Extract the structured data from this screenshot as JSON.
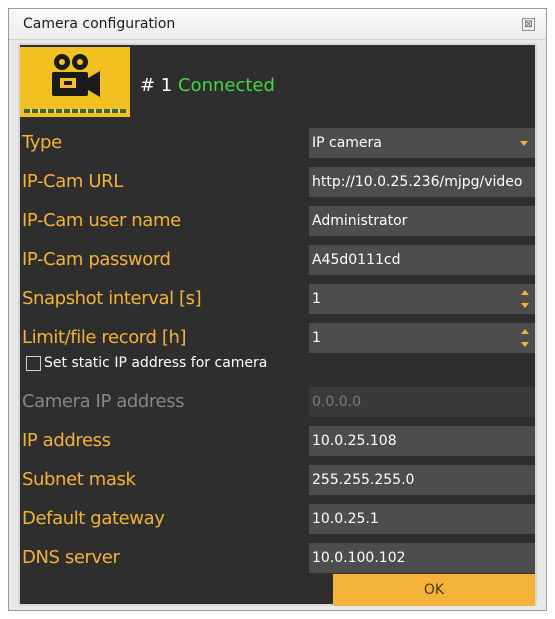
{
  "window": {
    "title": "Camera configuration",
    "close_glyph": "⊠"
  },
  "header": {
    "camera_number": "# 1",
    "status": "Connected",
    "icon": "film-camera-icon"
  },
  "fields": {
    "type": {
      "label": "Type",
      "value": "IP camera"
    },
    "url": {
      "label": "IP-Cam URL",
      "value": "http://10.0.25.236/mjpg/video"
    },
    "user": {
      "label": "IP-Cam user name",
      "value": "Administrator"
    },
    "password": {
      "label": "IP-Cam password",
      "value": "A45d0111cd"
    },
    "snapshot": {
      "label": "Snapshot interval [s]",
      "value": "1"
    },
    "limit": {
      "label": "Limit/file record [h]",
      "value": "1"
    },
    "camera_ip": {
      "label": "Camera IP address",
      "value": "0.0.0.0"
    },
    "ip": {
      "label": "IP address",
      "value": "10.0.25.108"
    },
    "subnet": {
      "label": "Subnet mask",
      "value": "255.255.255.0"
    },
    "gateway": {
      "label": "Default gateway",
      "value": "10.0.25.1"
    },
    "dns": {
      "label": "DNS server",
      "value": "10.0.100.102"
    }
  },
  "static_ip": {
    "label": "Set static IP address for camera",
    "checked": false
  },
  "buttons": {
    "ok": "OK"
  },
  "colors": {
    "accent": "#f4b338",
    "panel": "#2e2e2e",
    "field": "#4d4d4d",
    "connected": "#43d843"
  }
}
